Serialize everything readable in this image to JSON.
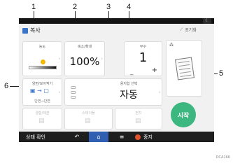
{
  "callouts": [
    "1",
    "2",
    "3",
    "4",
    "5",
    "6"
  ],
  "app": {
    "title": "복사",
    "reset_label": "초기화",
    "theme_icon": "moon-icon"
  },
  "tiles": {
    "density": {
      "label": "농도"
    },
    "zoom": {
      "label": "축소/확대",
      "value": "100%"
    },
    "quantity": {
      "label": "부수",
      "value": "1",
      "minus": "_",
      "plus": "+"
    },
    "duplex": {
      "label": "양면/모아찍기",
      "sub": "단면→단면"
    },
    "paper": {
      "label": "용지함 선택",
      "value": "자동"
    },
    "finish": {
      "label": "결합/제본"
    },
    "staple": {
      "label": "스테이플"
    },
    "punch": {
      "label": "펀치"
    }
  },
  "start_label": "시작",
  "bottom": {
    "status": "상태 확인",
    "back": "↶",
    "home": "⌂",
    "menu": "≡",
    "stop": "중지"
  },
  "figure_id": "DCA166"
}
